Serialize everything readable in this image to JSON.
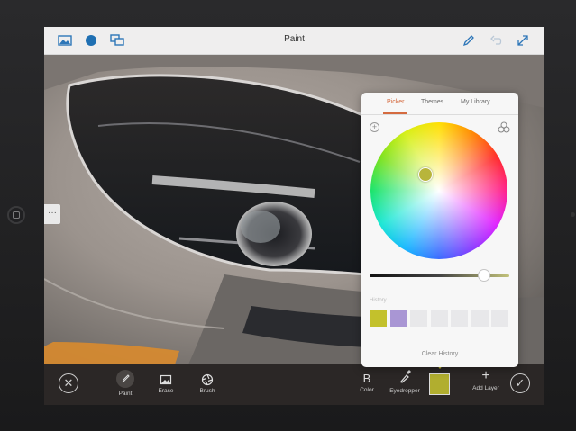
{
  "topbar": {
    "title": "Paint",
    "icons": [
      "image-icon",
      "color-dot-icon",
      "comments-icon",
      "pen-icon",
      "undo-icon",
      "expand-icon"
    ],
    "dot_color": "#1f6fb2"
  },
  "side_handle": {
    "label": "···"
  },
  "popover": {
    "tabs": [
      {
        "label": "Picker",
        "active": true
      },
      {
        "label": "Themes",
        "active": false
      },
      {
        "label": "My Library",
        "active": false
      }
    ],
    "accent": "#d56b40",
    "selected_color": "#b8b53b",
    "history_label": "History",
    "history": [
      "#c3c12c",
      "#a996d4",
      "#e8e8ea",
      "#e8e8ea",
      "#e8e8ea",
      "#e8e8ea",
      "#e8e8ea"
    ],
    "clear_history_label": "Clear History"
  },
  "bottombar": {
    "tools": [
      {
        "id": "paint",
        "label": "Paint"
      },
      {
        "id": "erase",
        "label": "Erase"
      },
      {
        "id": "brush",
        "label": "Brush"
      },
      {
        "id": "color",
        "label": "Color",
        "glyph": "B"
      },
      {
        "id": "eyedropper",
        "label": "Eyedropper"
      },
      {
        "id": "add-layer",
        "label": "Add Layer",
        "glyph": "+"
      }
    ],
    "current_color": "#b1ae2f"
  }
}
